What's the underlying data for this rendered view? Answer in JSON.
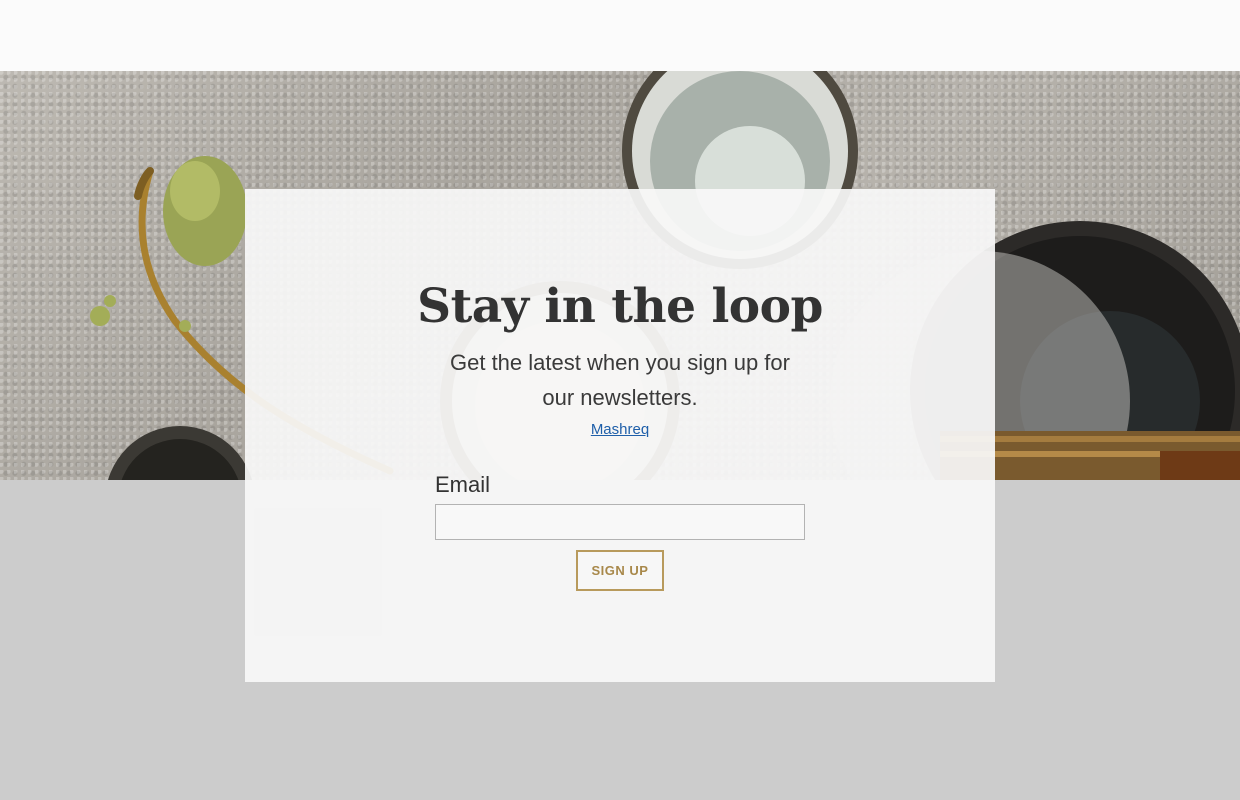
{
  "newsletter": {
    "title": "Stay in the loop",
    "subtitle": "Get the latest when you sign up for our newsletters.",
    "link_text": "Mashreq",
    "email_label": "Email",
    "email_value": "",
    "signup_label": "SIGN UP"
  },
  "colors": {
    "page_background": "#cccccc",
    "card_background": "#f7f7f7",
    "button_border": "#b89a5c",
    "button_text": "#a8884a",
    "link": "#1f5fa9",
    "heading": "#333333"
  },
  "icons": {
    "hero_image": "matcha-bowls-photo"
  }
}
